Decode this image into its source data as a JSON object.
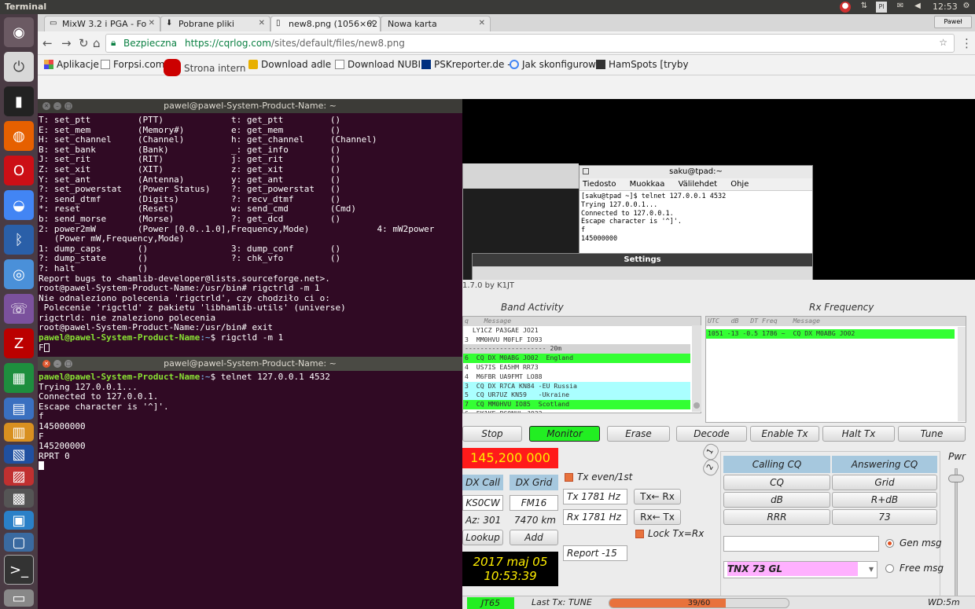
{
  "top_panel": {
    "app_name": "Terminal",
    "clock": "12:53",
    "keyboard_layout": "Pl",
    "session_user": "Paweł"
  },
  "browser": {
    "tabs": [
      {
        "label": "MixW 3.2 i PGA - Fo",
        "icon": "forum-icon"
      },
      {
        "label": "Pobrane pliki",
        "icon": "download-icon"
      },
      {
        "label": "new8.png (1056×62",
        "icon": "page-icon"
      },
      {
        "label": "Nowa karta",
        "icon": "none"
      }
    ],
    "secure_label": "Bezpieczna",
    "url_host": "https://cqrlog.com",
    "url_path": "/sites/default/files/new8.png",
    "bookmarks": [
      {
        "label": "Aplikacje",
        "icon": "apps-grid-icon"
      },
      {
        "label": "Forpsi.com",
        "icon": "page-icon"
      },
      {
        "label": "Strona intern",
        "icon": "red-globe-icon"
      },
      {
        "label": "Download adle M",
        "icon": "shield-icon"
      },
      {
        "label": "Download NUBIL",
        "icon": "page-icon"
      },
      {
        "label": "PSKreporter.de -",
        "icon": "psk-icon"
      },
      {
        "label": "Jak skonfigurow",
        "icon": "google-icon"
      },
      {
        "label": "HamSpots [tryby",
        "icon": "hamspots-icon"
      }
    ]
  },
  "terminal1": {
    "title": "pawel@pawel-System-Product-Name: ~",
    "lines": [
      "T: set_ptt         (PTT)             t: get_ptt         ()",
      "E: set_mem         (Memory#)         e: get_mem         ()",
      "H: set_channel     (Channel)         h: get_channel     (Channel)",
      "B: set_bank        (Bank)            _: get_info        ()",
      "J: set_rit         (RIT)             j: get_rit         ()",
      "Z: set_xit         (XIT)             z: get_xit         ()",
      "Y: set_ant         (Antenna)         y: get_ant         ()",
      "?: set_powerstat   (Power Status)    ?: get_powerstat   ()",
      "?: send_dtmf       (Digits)          ?: recv_dtmf       ()",
      "*: reset           (Reset)           w: send_cmd        (Cmd)",
      "b: send_morse      (Morse)           ?: get_dcd         ()",
      "2: power2mW        (Power [0.0..1.0],Frequency,Mode)             4: mW2power",
      "   (Power mW,Frequency,Mode)",
      "1: dump_caps       ()                3: dump_conf       ()",
      "?: dump_state      ()                ?: chk_vfo         ()",
      "?: halt            ()",
      "Report bugs to <hamlib-developer@lists.sourceforge.net>.",
      "root@pawel-System-Product-Name:/usr/bin# rigctrld -m 1",
      "Nie odnaleziono polecenia 'rigctrld', czy chodziło ci o:",
      " Polecenie 'rigctld' z pakietu 'libhamlib-utils' (universe)",
      "rigctrld: nie znaleziono polecenia",
      "root@pawel-System-Product-Name:/usr/bin# exit"
    ],
    "prompt_user": "pawel@pawel-System-Product-Name",
    "prompt_path": ":~",
    "prompt_cmd": "$ rigctld -m 1",
    "last_line": "F"
  },
  "terminal2": {
    "title": "pawel@pawel-System-Product-Name: ~",
    "prompt_user": "pawel@pawel-System-Product-Name",
    "prompt_path": ":~",
    "prompt_cmd": "$ telnet 127.0.0.1 4532",
    "lines": [
      "Trying 127.0.0.1...",
      "Connected to 127.0.0.1.",
      "Escape character is '^]'.",
      "f",
      "145000000",
      "F",
      "145200000",
      "RPRT 0"
    ]
  },
  "saku_terminal": {
    "title": "saku@tpad:~",
    "menu": [
      "Tiedosto",
      "Muokkaa",
      "Välilehdet",
      "Ohje"
    ],
    "lines": [
      "[saku@tpad ~]$ telnet 127.0.0.1 4532",
      "Trying 127.0.0.1...",
      "Connected to 127.0.0.1.",
      "Escape character is '^]'.",
      "f",
      "145000000"
    ]
  },
  "settings_window": {
    "title": "Settings"
  },
  "wsjt": {
    "title": "1.7.0   by K1JT",
    "band_activity_label": "Band Activity",
    "rx_frequency_label": "Rx Frequency",
    "band_header": "q    Message",
    "rx_header": "UTC   dB   DT Freq    Message",
    "band_rows": [
      {
        "text": "  LY1CZ PA3GAE JO21",
        "bg": "#ffffff"
      },
      {
        "text": "3  MM0HVU M0FLF IO93",
        "bg": "#ffffff"
      },
      {
        "text": "--------------------- 20m",
        "bg": "#d4d4d4"
      },
      {
        "text": "6  CQ DX M0ABG JO02  England",
        "bg": "#33ff33"
      },
      {
        "text": "4  US7IS EA5HM RR73",
        "bg": "#ffffff"
      },
      {
        "text": "4  M6FBR UA9FMT LO88",
        "bg": "#ffffff"
      },
      {
        "text": "3  CQ DX R7CA KN84 -EU Russia",
        "bg": "#aaffff"
      },
      {
        "text": "5  CQ UR7UZ KN59   -Ukraine",
        "bg": "#aaffff"
      },
      {
        "text": "7  CQ MM0HVU IO85  Scotland",
        "bg": "#33ff33"
      },
      {
        "text": "6  EK1KE PC0NUL JO22",
        "bg": "#ffffff"
      }
    ],
    "rx_rows": [
      {
        "text": "1051 -13 -0.5 1786 ~  CQ DX M0ABG JO02",
        "bg": "#33ff33"
      }
    ],
    "buttons": {
      "stop": "Stop",
      "monitor": "Monitor",
      "erase": "Erase",
      "decode": "Decode",
      "enable_tx": "Enable Tx",
      "halt_tx": "Halt Tx",
      "tune": "Tune"
    },
    "dial_frequency": "145,200 000",
    "dx_call_label": "DX Call",
    "dx_grid_label": "DX Grid",
    "dx_call": "KS0CW",
    "dx_grid": "FM16",
    "azimuth": "Az: 301",
    "distance": "7470 km",
    "lookup": "Lookup",
    "add": "Add",
    "tx_even": "Tx even/1st",
    "tx_freq": "Tx  1781  Hz",
    "rx_freq": "Rx  1781  Hz",
    "tx_from_rx": "Tx← Rx",
    "rx_from_tx": "Rx← Tx",
    "lock": "Lock Tx=Rx",
    "report": "Report -15",
    "date": "2017 maj 05",
    "time": "10:53:39",
    "tab1": "1",
    "tab2": "2",
    "pwr": "Pwr",
    "calling_cq": "Calling CQ",
    "answering_cq": "Answering CQ",
    "msg_buttons": [
      "CQ",
      "Grid",
      "dB",
      "R+dB",
      "RRR",
      "73"
    ],
    "gen_msg": "Gen msg",
    "free_msg": "Free msg",
    "free_text": "TNX 73 GL",
    "status_mode": "JT65",
    "last_tx": "Last Tx: TUNE",
    "progress_text": "39/60",
    "progress_fraction": 0.65,
    "wd": "WD:5m"
  }
}
